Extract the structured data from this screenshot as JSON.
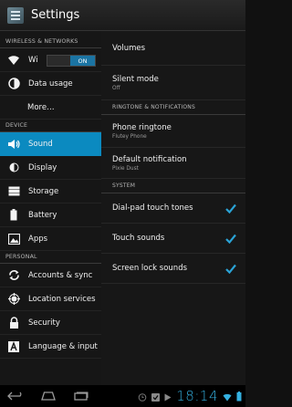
{
  "action_bar": {
    "title": "Settings",
    "icon": "settings-app-icon"
  },
  "left": {
    "wireless_header": "WIRELESS & NETWORKS",
    "wifi": {
      "label": "Wi",
      "toggle": "ON",
      "icon": "wifi-icon"
    },
    "data_usage": {
      "label": "Data usage",
      "icon": "data-usage-icon"
    },
    "more": {
      "label": "More…"
    },
    "device_header": "DEVICE",
    "sound": {
      "label": "Sound",
      "icon": "speaker-icon"
    },
    "display": {
      "label": "Display",
      "icon": "brightness-icon"
    },
    "storage": {
      "label": "Storage",
      "icon": "storage-icon"
    },
    "battery": {
      "label": "Battery",
      "icon": "battery-icon"
    },
    "apps": {
      "label": "Apps",
      "icon": "apps-icon"
    },
    "personal_header": "PERSONAL",
    "accounts": {
      "label": "Accounts & sync",
      "icon": "sync-icon"
    },
    "location": {
      "label": "Location services",
      "icon": "location-icon"
    },
    "security": {
      "label": "Security",
      "icon": "lock-icon"
    },
    "language": {
      "label": "Language & input",
      "icon": "language-icon"
    }
  },
  "right": {
    "volumes": "Volumes",
    "silent_mode": {
      "title": "Silent mode",
      "summary": "Off"
    },
    "ringtone_header": "RINGTONE & NOTIFICATIONS",
    "phone_ringtone": {
      "title": "Phone ringtone",
      "summary": "Flutey Phone"
    },
    "default_notification": {
      "title": "Default notification",
      "summary": "Pixie Dust"
    },
    "system_header": "SYSTEM",
    "dialpad": {
      "title": "Dial-pad touch tones",
      "checked": true
    },
    "touch_sounds": {
      "title": "Touch sounds",
      "checked": true
    },
    "screen_lock": {
      "title": "Screen lock sounds",
      "checked": true
    }
  },
  "navbar": {
    "clock": "18:14"
  },
  "colors": {
    "accent": "#0b8ac0",
    "clock": "#34b0e0"
  }
}
